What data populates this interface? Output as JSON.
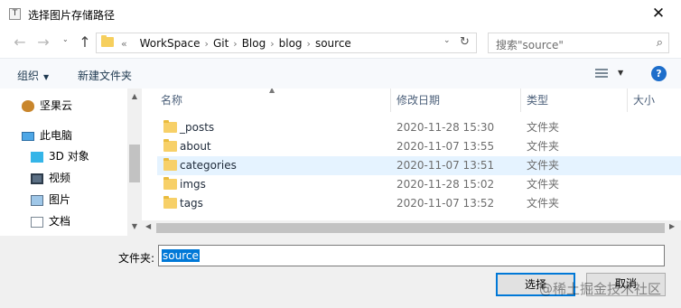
{
  "window": {
    "title": "选择图片存储路径",
    "app_icon": "T",
    "close_glyph": "✕"
  },
  "nav": {
    "back": "←",
    "forward": "→",
    "recent": "⌄",
    "up": "↑",
    "address": {
      "chevron": "«",
      "crumbs": [
        "WorkSpace",
        "Git",
        "Blog",
        "blog",
        "source"
      ],
      "separator": "›",
      "dropdown": "⌄",
      "refresh": "↻"
    },
    "search": {
      "placeholder": "搜索\"source\"",
      "icon": "search-icon"
    }
  },
  "toolbar": {
    "organize": "组织",
    "new_folder": "新建文件夹",
    "help": "?"
  },
  "sidebar": {
    "items": [
      {
        "label": "坚果云",
        "icon": "nut-icon"
      },
      {
        "label": "此电脑",
        "icon": "computer-icon"
      },
      {
        "label": "3D 对象",
        "icon": "cube-icon"
      },
      {
        "label": "视频",
        "icon": "video-icon"
      },
      {
        "label": "图片",
        "icon": "picture-icon"
      },
      {
        "label": "文档",
        "icon": "document-icon"
      }
    ]
  },
  "files": {
    "columns": [
      "名称",
      "修改日期",
      "类型",
      "大小"
    ],
    "rows": [
      {
        "name": "_posts",
        "date": "2020-11-28 15:30",
        "type": "文件夹"
      },
      {
        "name": "about",
        "date": "2020-11-07 13:55",
        "type": "文件夹"
      },
      {
        "name": "categories",
        "date": "2020-11-07 13:51",
        "type": "文件夹"
      },
      {
        "name": "imgs",
        "date": "2020-11-28 15:02",
        "type": "文件夹"
      },
      {
        "name": "tags",
        "date": "2020-11-07 13:52",
        "type": "文件夹"
      }
    ],
    "selected_index": 2
  },
  "footer": {
    "folder_label": "文件夹:",
    "folder_value": "source",
    "select_button": "选择",
    "cancel_button": "取消"
  },
  "watermark": "@稀土掘金技术社区",
  "colors": {
    "accent": "#0078d7",
    "selected_row": "#e5f3ff",
    "folder": "#f7d068"
  }
}
